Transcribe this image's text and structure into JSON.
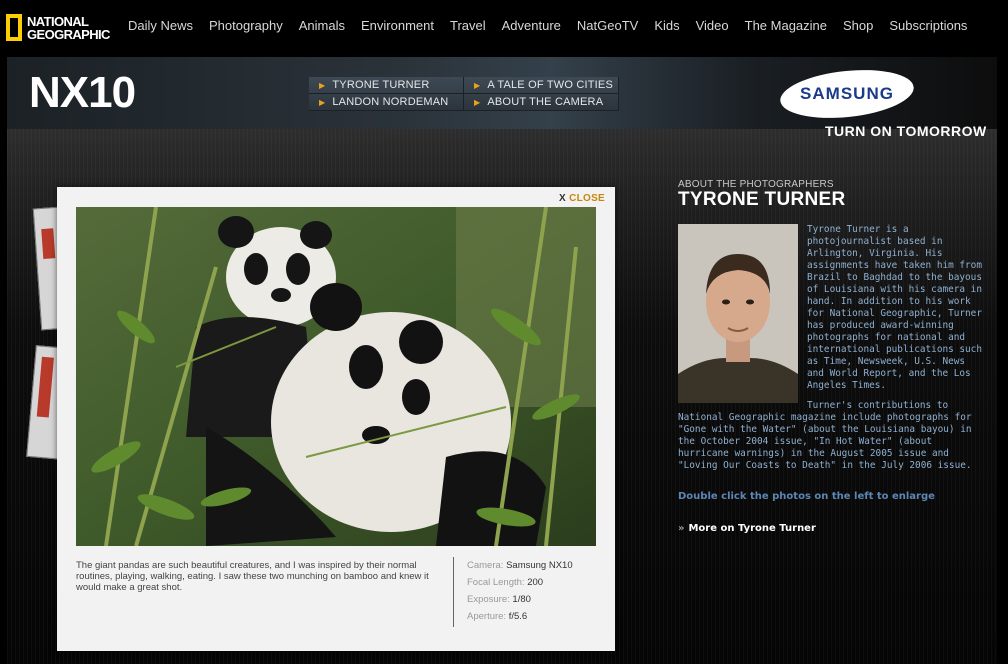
{
  "brand": {
    "logo_line1": "NATIONAL",
    "logo_line2": "GEOGRAPHIC",
    "logo_color": "#ffce00"
  },
  "topnav": {
    "links": [
      "Daily News",
      "Photography",
      "Animals",
      "Environment",
      "Travel",
      "Adventure",
      "NatGeoTV",
      "Kids",
      "Video",
      "The Magazine",
      "Shop",
      "Subscriptions"
    ]
  },
  "header": {
    "product": "NX10",
    "subnav": [
      "TYRONE TURNER",
      "A TALE OF TWO CITIES",
      "LANDON NORDEMAN",
      "ABOUT THE CAMERA"
    ],
    "sponsor": "SAMSUNG",
    "tagline": "TURN ON TOMORROW"
  },
  "card": {
    "close_x": "X",
    "close_label": "CLOSE",
    "caption": "The giant pandas are such beautiful creatures, and I was inspired by their normal routines, playing, walking, eating. I saw these two munching on bamboo and knew it would make a great shot.",
    "meta": {
      "camera_label": "Camera:",
      "camera": "Samsung NX10",
      "focal_label": "Focal Length:",
      "focal": "200",
      "exposure_label": "Exposure:",
      "exposure": "1/80",
      "aperture_label": "Aperture:",
      "aperture": "f/5.6"
    }
  },
  "about": {
    "eyebrow": "ABOUT THE PHOTOGRAPHERS",
    "name": "TYRONE TURNER",
    "bio1": "Tyrone Turner is a photojournalist based in Arlington, Virginia. His assignments have taken him from Brazil to Baghdad to the bayous of Louisiana with his camera in hand. In addition to his work for National Geographic, Turner has produced award-winning photographs for national and international publications such as Time, Newsweek, U.S. News and World Report, and the Los Angeles Times.",
    "bio2": "Turner's contributions to National Geographic magazine include photographs for \"Gone with the Water\" (about the Louisiana bayou) in the October 2004 issue, \"In Hot Water\" (about hurricane warnings) in the August 2005 issue and \"Loving Our Coasts to Death\" in the July 2006 issue.",
    "hint": "Double click the photos on the left to enlarge",
    "more_bullet": "»",
    "more": "More on Tyrone Turner"
  }
}
